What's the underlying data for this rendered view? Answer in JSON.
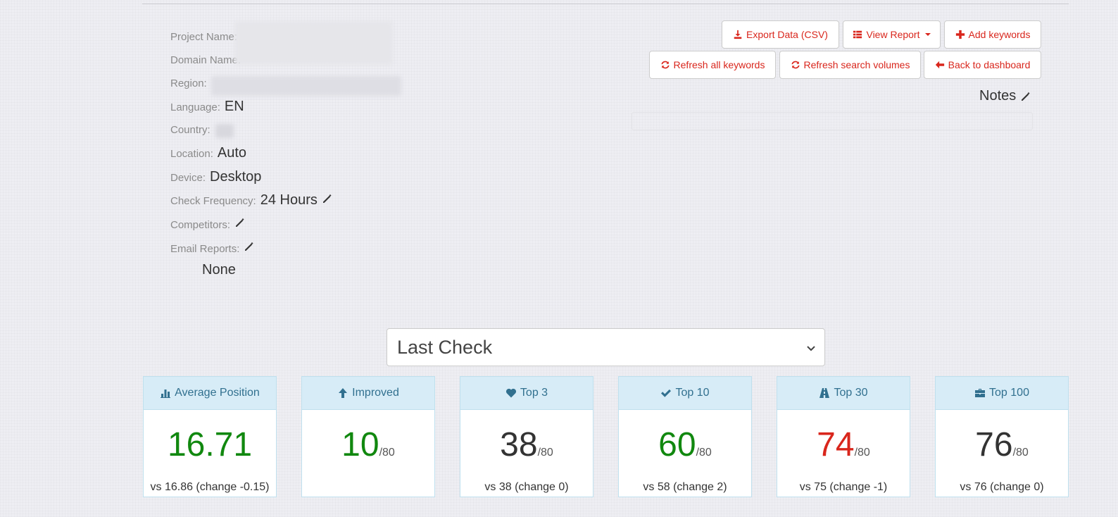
{
  "project_info": {
    "project_name_label": "Project Name:",
    "domain_name_label": "Domain Name:",
    "region_label": "Region:",
    "language_label": "Language:",
    "language_value": "EN",
    "country_label": "Country:",
    "location_label": "Location:",
    "location_value": "Auto",
    "device_label": "Device:",
    "device_value": "Desktop",
    "check_frequency_label": "Check Frequency:",
    "check_frequency_value": "24 Hours",
    "competitors_label": "Competitors:",
    "email_reports_label": "Email Reports:",
    "email_reports_value": "None"
  },
  "toolbar": {
    "export_label": "Export Data (CSV)",
    "view_report_label": "View Report",
    "add_keywords_label": "Add keywords",
    "refresh_all_label": "Refresh all keywords",
    "refresh_volumes_label": "Refresh search volumes",
    "back_label": "Back to dashboard"
  },
  "notes_label": "Notes",
  "period_select": {
    "selected": "Last Check"
  },
  "stats": [
    {
      "title": "Average Position",
      "icon": "bar-chart-icon",
      "value": "16.71",
      "total": "",
      "comparison": "vs 16.86 (change -0.15)",
      "color": "#11880f"
    },
    {
      "title": "Improved",
      "icon": "arrow-up-icon",
      "value": "10",
      "total": "/80",
      "comparison": "",
      "color": "#11880f"
    },
    {
      "title": "Top 3",
      "icon": "heart-icon",
      "value": "38",
      "total": "/80",
      "comparison": "vs 38 (change 0)",
      "color": "#333333"
    },
    {
      "title": "Top 10",
      "icon": "check-icon",
      "value": "60",
      "total": "/80",
      "comparison": "vs 58 (change 2)",
      "color": "#11880f"
    },
    {
      "title": "Top 30",
      "icon": "road-icon",
      "value": "74",
      "total": "/80",
      "comparison": "vs 75 (change -1)",
      "color": "#d9261c"
    },
    {
      "title": "Top 100",
      "icon": "briefcase-icon",
      "value": "76",
      "total": "/80",
      "comparison": "vs 76 (change 0)",
      "color": "#333333"
    }
  ]
}
